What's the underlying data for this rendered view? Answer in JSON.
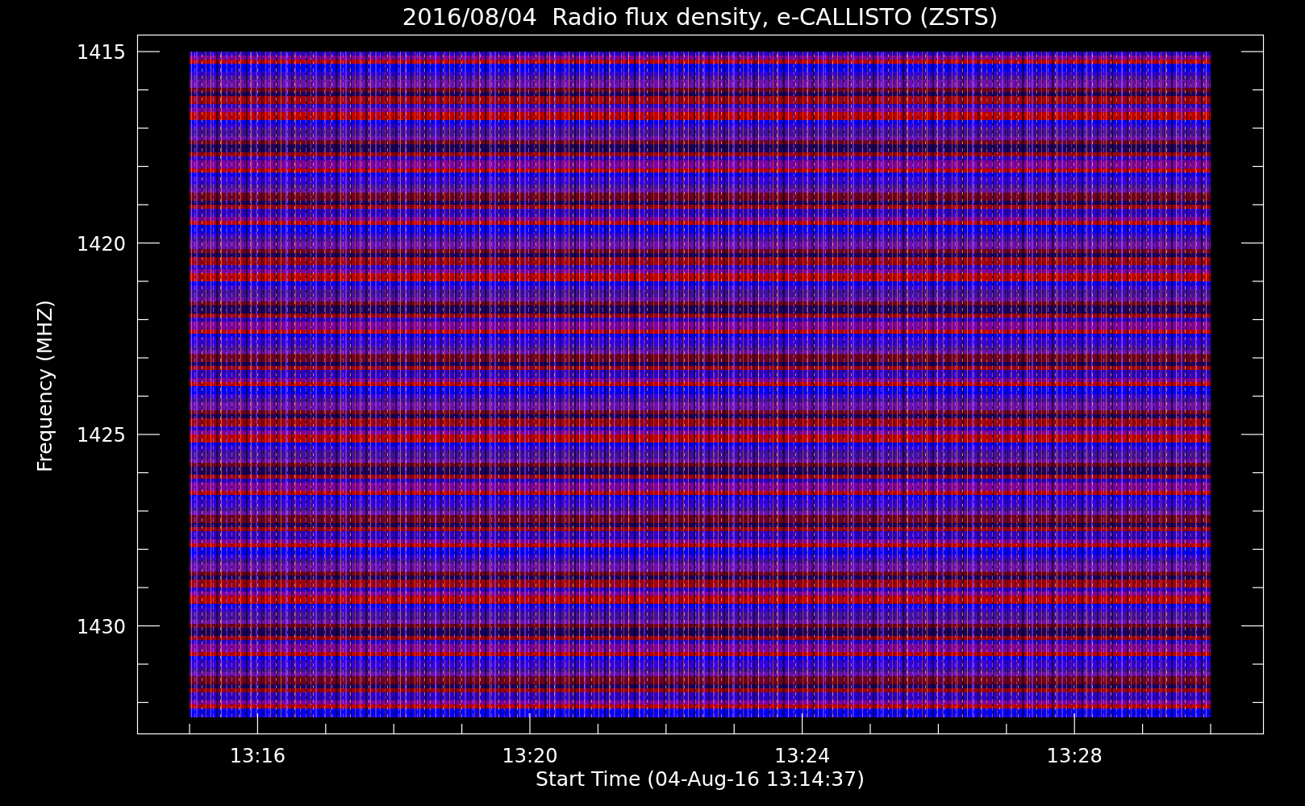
{
  "title": "2016/08/04  Radio flux density, e-CALLISTO (ZSTS)",
  "y_axis": {
    "label": "Frequency (MHZ)",
    "ticks": [
      "1415",
      "1420",
      "1425",
      "1430"
    ]
  },
  "x_axis": {
    "label": "Start Time (04-Aug-16 13:14:37)",
    "ticks": [
      "13:16",
      "13:20",
      "13:24",
      "13:28"
    ]
  }
}
